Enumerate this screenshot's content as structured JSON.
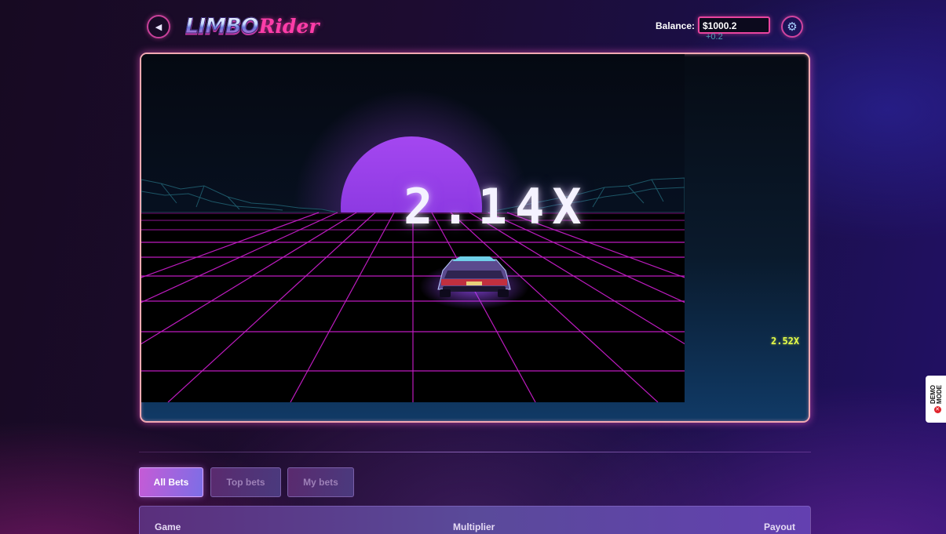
{
  "header": {
    "back_icon": "back-arrow-icon",
    "logo": {
      "part1": "LIMBO",
      "part2": "Rider"
    },
    "balance_label": "Balance:",
    "balance_value": "$1000.2",
    "balance_delta": "+0.2",
    "settings_icon": "gear-icon"
  },
  "game": {
    "multiplier": "2.14X",
    "side_multiplier": "2.52X"
  },
  "tabs": [
    {
      "label": "All Bets",
      "active": true
    },
    {
      "label": "Top bets",
      "active": false
    },
    {
      "label": "My bets",
      "active": false
    }
  ],
  "table": {
    "columns": [
      "Game",
      "Multiplier",
      "Payout"
    ]
  },
  "demo_badge": {
    "line1": "DEMO",
    "line2": "MODE"
  },
  "colors": {
    "accent_pink": "#e8449f",
    "grid_magenta": "#d21fd4",
    "sun_purple": "#a646f2",
    "side_multiplier_yellow": "#e7ff48",
    "frame_border": "#f2a9b2"
  }
}
